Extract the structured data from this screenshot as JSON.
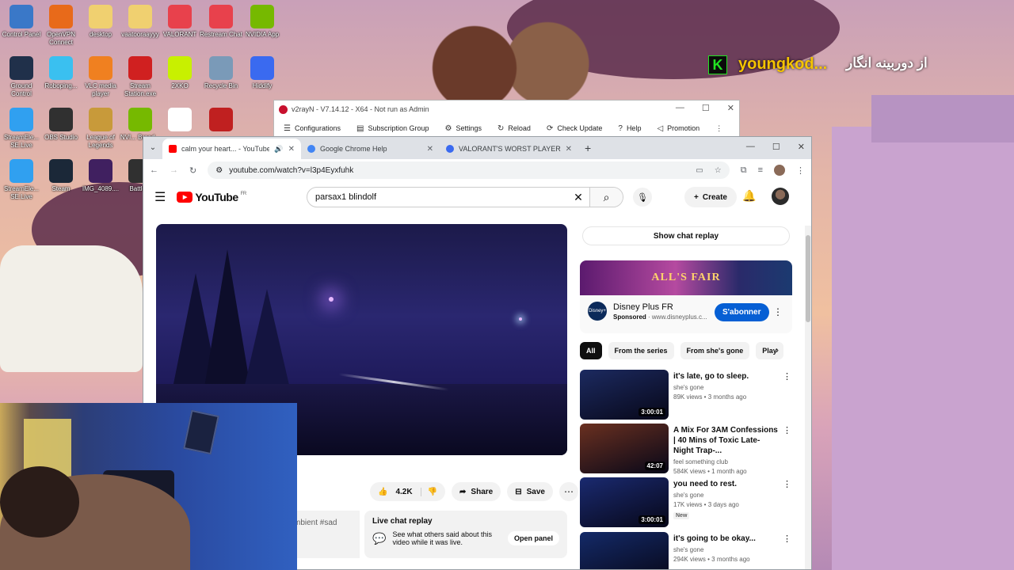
{
  "desktop": {
    "icons": [
      {
        "label": "Control Panel",
        "color": "#3a78c8"
      },
      {
        "label": "OpenVPN Connect",
        "color": "#e86a1a"
      },
      {
        "label": "desktop",
        "color": "#f0d070"
      },
      {
        "label": "vaatooraayyy",
        "color": "#f0d070"
      },
      {
        "label": "VALORANT",
        "color": "#e8414c"
      },
      {
        "label": "Restream Chat",
        "color": "#e8414c"
      },
      {
        "label": "NVIDIA App",
        "color": "#76b900"
      },
      {
        "label": "Ground Control",
        "color": "#20304a"
      },
      {
        "label": "Roboping...",
        "color": "#3ac0f0"
      },
      {
        "label": "VLC media player",
        "color": "#f08020"
      },
      {
        "label": "Stream Station.exe",
        "color": "#d02020"
      },
      {
        "label": "2XKO",
        "color": "#c8f000"
      },
      {
        "label": "Recycle Bin",
        "color": "#7a9ab8"
      },
      {
        "label": "Hiddify",
        "color": "#3a6af0"
      },
      {
        "label": "StreamEle... SE.Live",
        "color": "#30a0f0"
      },
      {
        "label": "OBS Studio",
        "color": "#303030"
      },
      {
        "label": "League of Legends",
        "color": "#c89a3a"
      },
      {
        "label": "NVI... Broad...",
        "color": "#76b900"
      },
      {
        "label": "",
        "color": "#ffffff"
      },
      {
        "label": "",
        "color": "#c02020"
      },
      {
        "label": "StreamEle... SE.Live",
        "color": "#30a0f0"
      },
      {
        "label": "Steam",
        "color": "#1b2838"
      },
      {
        "label": "IMG_4089....",
        "color": "#402060"
      },
      {
        "label": "Battle...",
        "color": "#303030"
      }
    ],
    "overlay_brand": "youngkod...",
    "overlay_farsi": "از دوربینه انگار",
    "overlay_k": "K"
  },
  "v2ray": {
    "title": "v2rayN - V7.14.12 - X64 - Not run as Admin",
    "menu": [
      "Configurations",
      "Subscription Group",
      "Settings",
      "Reload",
      "Check Update",
      "Help",
      "Promotion"
    ]
  },
  "chrome": {
    "tabs": [
      {
        "title": "calm your heart... - YouTube",
        "color": "#ff0000"
      },
      {
        "title": "Google Chrome Help",
        "color": "#4285f4"
      },
      {
        "title": "VALORANT'S WORST PLAYER R",
        "color": "#3a6af0"
      }
    ],
    "url": "youtube.com/watch?v=l3p4Eyxfuhk"
  },
  "youtube": {
    "logo": "YouTube",
    "region": "FR",
    "search_query": "parsax1 blindolf",
    "create_label": "Create",
    "likes": "4.2K",
    "share_label": "Share",
    "save_label": "Save",
    "description_fragment": "mbient #sad",
    "live_chat": {
      "heading": "Live chat replay",
      "text": "See what others said about this video while it was live.",
      "button": "Open panel"
    },
    "show_chat_replay": "Show chat replay",
    "ad": {
      "banner": "ALL'S FAIR",
      "channel": "Disney Plus FR",
      "sponsored": "Sponsored",
      "domain": "www.disneyplus.c...",
      "logo_text": "Disney+",
      "subscribe": "S'abonner"
    },
    "chips": [
      "All",
      "From the series",
      "From she's gone",
      "Play"
    ],
    "related": [
      {
        "title": "it's late, go to sleep.",
        "channel": "she's gone",
        "meta": "89K views • 3 months ago",
        "duration": "3:00:01",
        "badge": "",
        "thumb": "#1c2a60"
      },
      {
        "title": "A Mix For 3AM Confessions | 40 Mins of Toxic Late-Night Trap-...",
        "channel": "feel something club",
        "meta": "584K views • 1 month ago",
        "duration": "42:07",
        "badge": "",
        "thumb": "#6a3020"
      },
      {
        "title": "you need to rest.",
        "channel": "she's gone",
        "meta": "17K views • 3 days ago",
        "duration": "3:00:01",
        "badge": "New",
        "thumb": "#1a2a70"
      },
      {
        "title": "it's going to be okay...",
        "channel": "she's gone",
        "meta": "294K views • 3 months ago",
        "duration": "",
        "badge": "",
        "thumb": "#142a68"
      }
    ]
  }
}
